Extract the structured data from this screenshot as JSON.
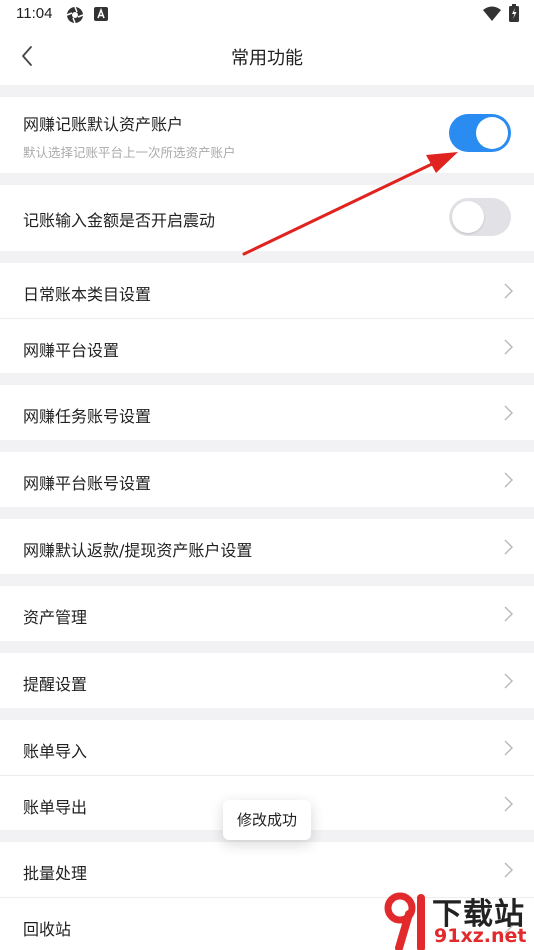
{
  "status_bar": {
    "time": "11:04",
    "icons": [
      "aperture-icon",
      "a-box-icon",
      "wifi-icon",
      "battery-charging-icon"
    ]
  },
  "header": {
    "title": "常用功能",
    "back_icon": "chevron-left-icon"
  },
  "settings": {
    "default_account": {
      "label": "网赚记账默认资产账户",
      "description": "默认选择记账平台上一次所选资产账户",
      "enabled": true
    },
    "vibration": {
      "label": "记账输入金额是否开启震动",
      "enabled": false
    }
  },
  "menu": {
    "daily_category": "日常账本类目设置",
    "platform_settings": "网赚平台设置",
    "task_accounts": "网赚任务账号设置",
    "platform_accounts": "网赚平台账号设置",
    "refund_withdraw": "网赚默认返款/提现资产账户设置",
    "asset_management": "资产管理",
    "reminders": "提醒设置",
    "bill_import": "账单导入",
    "bill_export": "账单导出",
    "batch_processing": "批量处理",
    "recycle_bin": "回收站"
  },
  "toast": {
    "message": "修改成功"
  },
  "watermark": {
    "brand": "下载站",
    "site": "91xz.net"
  },
  "colors": {
    "accent": "#2a8cf0",
    "toggle_off": "#e2e2e6",
    "annotation_arrow": "#e0231f",
    "background": "#f2f2f4"
  }
}
